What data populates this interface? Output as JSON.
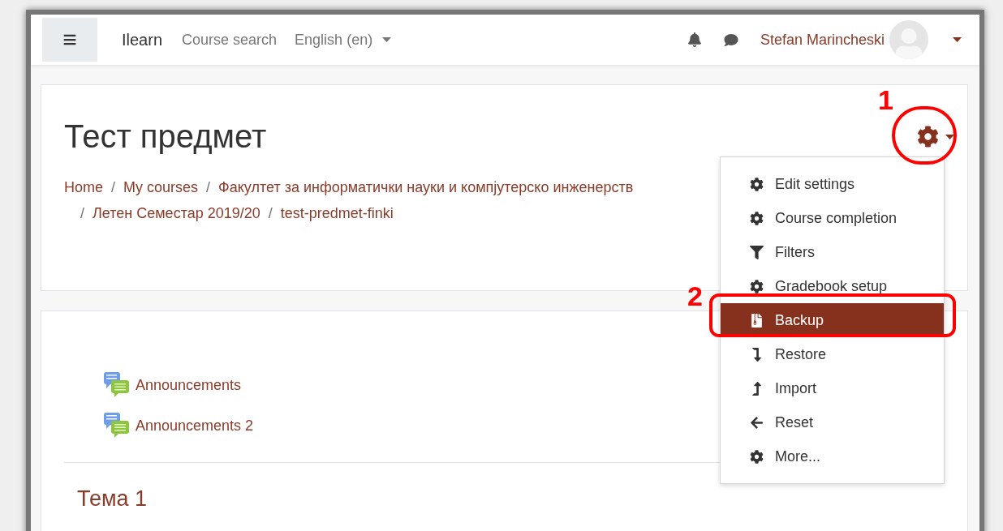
{
  "navbar": {
    "menu_button": "≡",
    "site_name": "Ilearn",
    "links": [
      "Course search"
    ],
    "language": "English (en)",
    "user_name": "Stefan Marincheski"
  },
  "course_header": {
    "title": "Тест предмет",
    "separator": "/",
    "breadcrumb_lines": [
      [
        "Home",
        "My courses",
        "Факултет за информатички науки и компјутерско инженерств"
      ],
      [
        "Летен Семестар 2019/20",
        "test-predmet-finki"
      ]
    ]
  },
  "settings_menu": {
    "items": [
      {
        "label": "Edit settings",
        "selected": false
      },
      {
        "label": "Course completion",
        "selected": false
      },
      {
        "label": "Filters",
        "selected": false
      },
      {
        "label": "Gradebook setup",
        "selected": false
      },
      {
        "label": "Backup",
        "selected": true
      },
      {
        "label": "Restore",
        "selected": false
      },
      {
        "label": "Import",
        "selected": false
      },
      {
        "label": "Reset",
        "selected": false
      },
      {
        "label": "More...",
        "selected": false
      }
    ]
  },
  "annotations": [
    {
      "label": "1"
    },
    {
      "label": "2"
    }
  ],
  "course_content": {
    "activities": [
      "Announcements",
      "Announcements 2"
    ],
    "section_title": "Тема 1"
  }
}
